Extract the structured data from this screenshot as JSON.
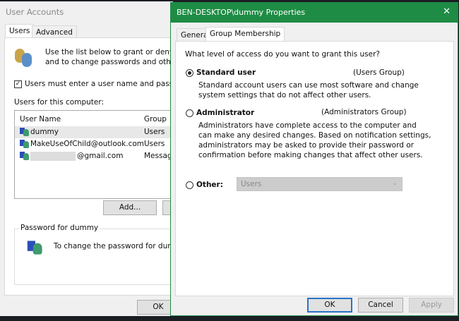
{
  "user_accounts": {
    "title": "User Accounts",
    "tabs": [
      "Users",
      "Advanced"
    ],
    "intro_line1": "Use the list below to grant or deny use",
    "intro_line2": "and to change passwords and other se",
    "must_enter_checkbox": {
      "label": "Users must enter a user name and password",
      "checked": true
    },
    "users_label": "Users for this computer:",
    "columns": [
      "User Name",
      "Group"
    ],
    "rows": [
      {
        "name": "dummy",
        "group": "Users"
      },
      {
        "name": "MakeUseOfChild@outlook.com",
        "group": "Users"
      },
      {
        "name": "@gmail.com",
        "group": "Message"
      }
    ],
    "add_button": "Add...",
    "password_group": "Password for dummy",
    "password_text": "To change the password for dummy",
    "ok_button": "OK"
  },
  "properties": {
    "title": "BEN-DESKTOP\\dummy Properties",
    "close": "✕",
    "tabs": [
      "General",
      "Group Membership"
    ],
    "question": "What level of access do you want to grant this user?",
    "options": [
      {
        "label": "Standard user",
        "group": "(Users Group)",
        "selected": true,
        "desc": [
          "Standard account users can use most software and change",
          "system settings that do not affect other users."
        ]
      },
      {
        "label": "Administrator",
        "group": "(Administrators Group)",
        "selected": false,
        "desc": [
          "Administrators have complete access to the computer and",
          "can make any desired changes. Based on notification settings,",
          "administrators may be asked to provide their password or",
          "confirmation before making changes that affect other users."
        ]
      }
    ],
    "other_label": "Other:",
    "other_value": "Users",
    "ok": "OK",
    "cancel": "Cancel",
    "apply": "Apply"
  }
}
